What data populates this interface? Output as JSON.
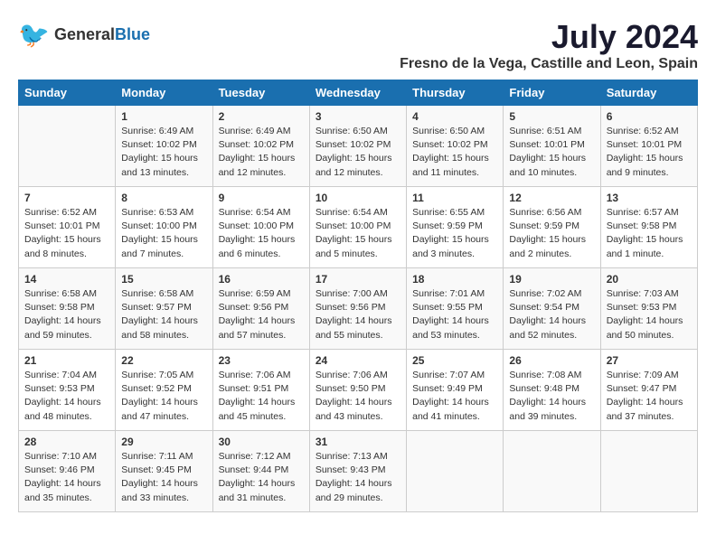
{
  "header": {
    "logo_general": "General",
    "logo_blue": "Blue",
    "month": "July 2024",
    "location": "Fresno de la Vega, Castille and Leon, Spain"
  },
  "days_of_week": [
    "Sunday",
    "Monday",
    "Tuesday",
    "Wednesday",
    "Thursday",
    "Friday",
    "Saturday"
  ],
  "weeks": [
    [
      {
        "num": "",
        "sunrise": "",
        "sunset": "",
        "daylight": ""
      },
      {
        "num": "1",
        "sunrise": "Sunrise: 6:49 AM",
        "sunset": "Sunset: 10:02 PM",
        "daylight": "Daylight: 15 hours and 13 minutes."
      },
      {
        "num": "2",
        "sunrise": "Sunrise: 6:49 AM",
        "sunset": "Sunset: 10:02 PM",
        "daylight": "Daylight: 15 hours and 12 minutes."
      },
      {
        "num": "3",
        "sunrise": "Sunrise: 6:50 AM",
        "sunset": "Sunset: 10:02 PM",
        "daylight": "Daylight: 15 hours and 12 minutes."
      },
      {
        "num": "4",
        "sunrise": "Sunrise: 6:50 AM",
        "sunset": "Sunset: 10:02 PM",
        "daylight": "Daylight: 15 hours and 11 minutes."
      },
      {
        "num": "5",
        "sunrise": "Sunrise: 6:51 AM",
        "sunset": "Sunset: 10:01 PM",
        "daylight": "Daylight: 15 hours and 10 minutes."
      },
      {
        "num": "6",
        "sunrise": "Sunrise: 6:52 AM",
        "sunset": "Sunset: 10:01 PM",
        "daylight": "Daylight: 15 hours and 9 minutes."
      }
    ],
    [
      {
        "num": "7",
        "sunrise": "Sunrise: 6:52 AM",
        "sunset": "Sunset: 10:01 PM",
        "daylight": "Daylight: 15 hours and 8 minutes."
      },
      {
        "num": "8",
        "sunrise": "Sunrise: 6:53 AM",
        "sunset": "Sunset: 10:00 PM",
        "daylight": "Daylight: 15 hours and 7 minutes."
      },
      {
        "num": "9",
        "sunrise": "Sunrise: 6:54 AM",
        "sunset": "Sunset: 10:00 PM",
        "daylight": "Daylight: 15 hours and 6 minutes."
      },
      {
        "num": "10",
        "sunrise": "Sunrise: 6:54 AM",
        "sunset": "Sunset: 10:00 PM",
        "daylight": "Daylight: 15 hours and 5 minutes."
      },
      {
        "num": "11",
        "sunrise": "Sunrise: 6:55 AM",
        "sunset": "Sunset: 9:59 PM",
        "daylight": "Daylight: 15 hours and 3 minutes."
      },
      {
        "num": "12",
        "sunrise": "Sunrise: 6:56 AM",
        "sunset": "Sunset: 9:59 PM",
        "daylight": "Daylight: 15 hours and 2 minutes."
      },
      {
        "num": "13",
        "sunrise": "Sunrise: 6:57 AM",
        "sunset": "Sunset: 9:58 PM",
        "daylight": "Daylight: 15 hours and 1 minute."
      }
    ],
    [
      {
        "num": "14",
        "sunrise": "Sunrise: 6:58 AM",
        "sunset": "Sunset: 9:58 PM",
        "daylight": "Daylight: 14 hours and 59 minutes."
      },
      {
        "num": "15",
        "sunrise": "Sunrise: 6:58 AM",
        "sunset": "Sunset: 9:57 PM",
        "daylight": "Daylight: 14 hours and 58 minutes."
      },
      {
        "num": "16",
        "sunrise": "Sunrise: 6:59 AM",
        "sunset": "Sunset: 9:56 PM",
        "daylight": "Daylight: 14 hours and 57 minutes."
      },
      {
        "num": "17",
        "sunrise": "Sunrise: 7:00 AM",
        "sunset": "Sunset: 9:56 PM",
        "daylight": "Daylight: 14 hours and 55 minutes."
      },
      {
        "num": "18",
        "sunrise": "Sunrise: 7:01 AM",
        "sunset": "Sunset: 9:55 PM",
        "daylight": "Daylight: 14 hours and 53 minutes."
      },
      {
        "num": "19",
        "sunrise": "Sunrise: 7:02 AM",
        "sunset": "Sunset: 9:54 PM",
        "daylight": "Daylight: 14 hours and 52 minutes."
      },
      {
        "num": "20",
        "sunrise": "Sunrise: 7:03 AM",
        "sunset": "Sunset: 9:53 PM",
        "daylight": "Daylight: 14 hours and 50 minutes."
      }
    ],
    [
      {
        "num": "21",
        "sunrise": "Sunrise: 7:04 AM",
        "sunset": "Sunset: 9:53 PM",
        "daylight": "Daylight: 14 hours and 48 minutes."
      },
      {
        "num": "22",
        "sunrise": "Sunrise: 7:05 AM",
        "sunset": "Sunset: 9:52 PM",
        "daylight": "Daylight: 14 hours and 47 minutes."
      },
      {
        "num": "23",
        "sunrise": "Sunrise: 7:06 AM",
        "sunset": "Sunset: 9:51 PM",
        "daylight": "Daylight: 14 hours and 45 minutes."
      },
      {
        "num": "24",
        "sunrise": "Sunrise: 7:06 AM",
        "sunset": "Sunset: 9:50 PM",
        "daylight": "Daylight: 14 hours and 43 minutes."
      },
      {
        "num": "25",
        "sunrise": "Sunrise: 7:07 AM",
        "sunset": "Sunset: 9:49 PM",
        "daylight": "Daylight: 14 hours and 41 minutes."
      },
      {
        "num": "26",
        "sunrise": "Sunrise: 7:08 AM",
        "sunset": "Sunset: 9:48 PM",
        "daylight": "Daylight: 14 hours and 39 minutes."
      },
      {
        "num": "27",
        "sunrise": "Sunrise: 7:09 AM",
        "sunset": "Sunset: 9:47 PM",
        "daylight": "Daylight: 14 hours and 37 minutes."
      }
    ],
    [
      {
        "num": "28",
        "sunrise": "Sunrise: 7:10 AM",
        "sunset": "Sunset: 9:46 PM",
        "daylight": "Daylight: 14 hours and 35 minutes."
      },
      {
        "num": "29",
        "sunrise": "Sunrise: 7:11 AM",
        "sunset": "Sunset: 9:45 PM",
        "daylight": "Daylight: 14 hours and 33 minutes."
      },
      {
        "num": "30",
        "sunrise": "Sunrise: 7:12 AM",
        "sunset": "Sunset: 9:44 PM",
        "daylight": "Daylight: 14 hours and 31 minutes."
      },
      {
        "num": "31",
        "sunrise": "Sunrise: 7:13 AM",
        "sunset": "Sunset: 9:43 PM",
        "daylight": "Daylight: 14 hours and 29 minutes."
      },
      {
        "num": "",
        "sunrise": "",
        "sunset": "",
        "daylight": ""
      },
      {
        "num": "",
        "sunrise": "",
        "sunset": "",
        "daylight": ""
      },
      {
        "num": "",
        "sunrise": "",
        "sunset": "",
        "daylight": ""
      }
    ]
  ]
}
